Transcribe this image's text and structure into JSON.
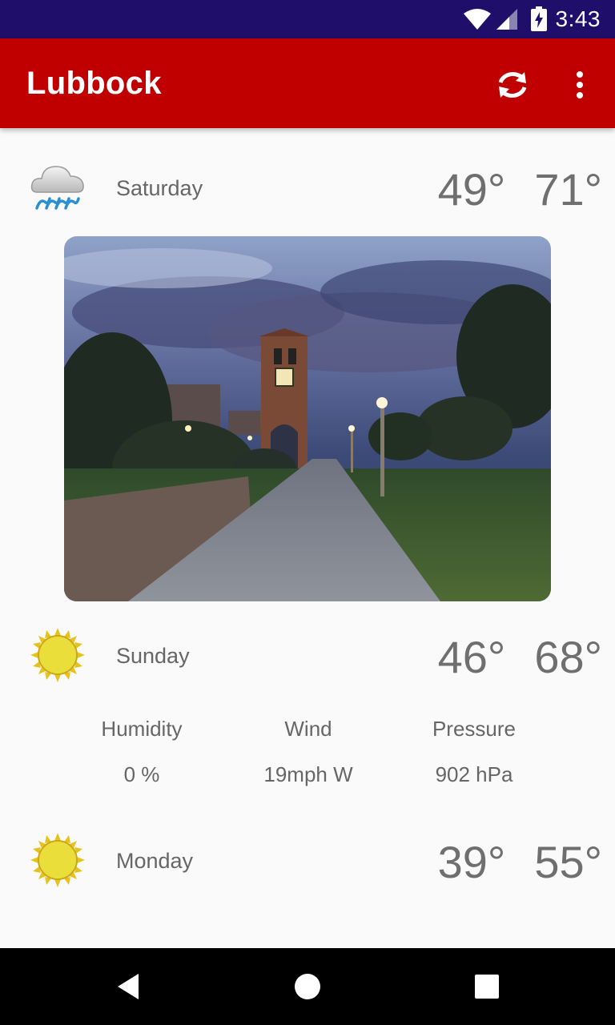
{
  "status_bar": {
    "time": "3:43"
  },
  "app_bar": {
    "title": "Lubbock",
    "refresh_icon": "refresh-icon",
    "more_icon": "more-vert-icon"
  },
  "forecast": [
    {
      "day": "Saturday",
      "low": "49°",
      "high": "71°",
      "icon": "rain-cloud-icon"
    },
    {
      "day": "Sunday",
      "low": "46°",
      "high": "68°",
      "icon": "sun-icon"
    },
    {
      "day": "Monday",
      "low": "39°",
      "high": "55°",
      "icon": "sun-icon"
    },
    {
      "day": "",
      "low": "",
      "high": "",
      "icon": "cloud-icon"
    }
  ],
  "details": {
    "humidity_label": "Humidity",
    "humidity_value": "0 %",
    "wind_label": "Wind",
    "wind_value": "19mph W",
    "pressure_label": "Pressure",
    "pressure_value": "902 hPa"
  },
  "colors": {
    "status_bar": "#1f0f6b",
    "app_bar": "#c00000",
    "background": "#fafafa"
  }
}
